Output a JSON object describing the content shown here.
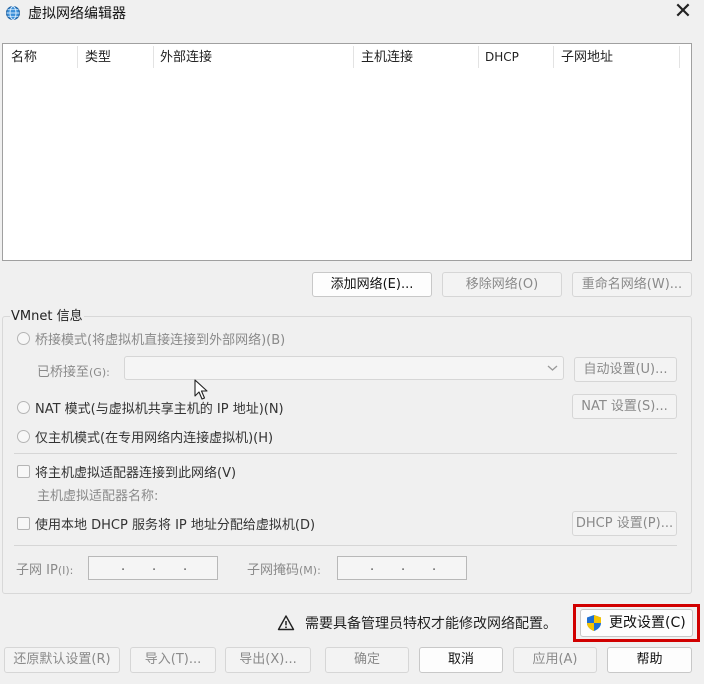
{
  "window": {
    "title": "虚拟网络编辑器",
    "close_symbol": "✕",
    "icon": "network-globe-icon"
  },
  "list": {
    "columns": [
      "名称",
      "类型",
      "外部连接",
      "主机连接",
      "DHCP",
      "子网地址"
    ],
    "rows": []
  },
  "list_buttons": {
    "add": "添加网络(E)...",
    "remove": "移除网络(O)",
    "rename": "重命名网络(W)..."
  },
  "vmnet_info": {
    "title": "VMnet 信息",
    "bridged_radio": "桥接模式(将虚拟机直接连接到外部网络)(B)",
    "bridged_to_label": "已桥接至",
    "bridged_to_accel": "(G):",
    "bridged_to_value": "",
    "auto_settings": "自动设置(U)...",
    "nat_radio": "NAT 模式(与虚拟机共享主机的 IP 地址)(N)",
    "nat_settings": "NAT 设置(S)...",
    "hostonly_radio": "仅主机模式(在专用网络内连接虚拟机)(H)",
    "connect_adapter_check": "将主机虚拟适配器连接到此网络(V)",
    "adapter_name_label": "主机虚拟适配器名称:",
    "dhcp_check": "使用本地 DHCP 服务将 IP 地址分配给虚拟机(D)",
    "dhcp_settings": "DHCP 设置(P)...",
    "subnet_ip_label": "子网 IP",
    "subnet_ip_accel": "(I):",
    "subnet_mask_label": "子网掩码",
    "subnet_mask_accel": "(M):",
    "ip_dot": "."
  },
  "warning": {
    "icon": "warning-triangle-icon",
    "text": "需要具备管理员特权才能修改网络配置。",
    "change_settings": "更改设置(C)"
  },
  "footer": {
    "restore_defaults": "还原默认设置(R)",
    "import": "导入(T)...",
    "export": "导出(X)...",
    "ok": "确定",
    "cancel": "取消",
    "apply": "应用(A)",
    "help": "帮助"
  },
  "colors": {
    "window_bg": "#f0f0f0",
    "highlight_border": "#d10000",
    "disabled_text": "#8a8a8a",
    "shield_blue": "#1f6fd1",
    "shield_yellow": "#f5c400"
  }
}
